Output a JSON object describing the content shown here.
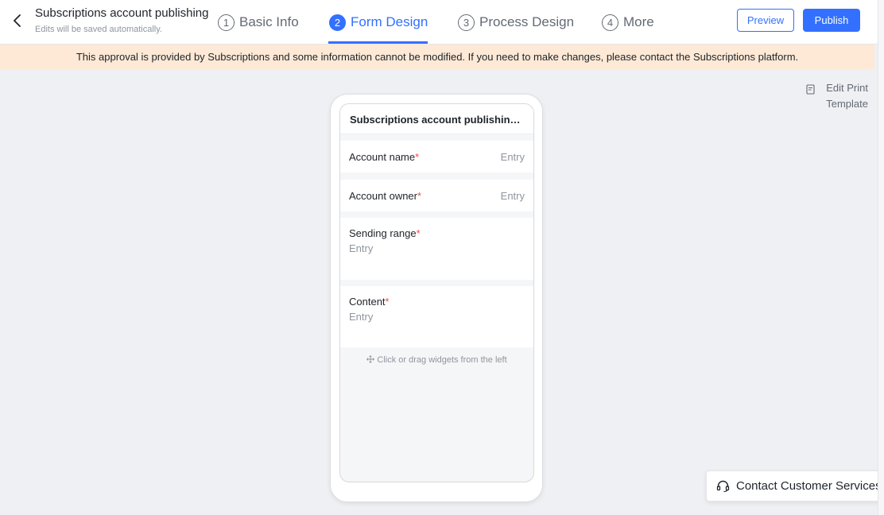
{
  "header": {
    "title": "Subscriptions account publishing",
    "subtitle": "Edits will be saved automatically.",
    "steps": [
      {
        "num": "1",
        "label": "Basic Info"
      },
      {
        "num": "2",
        "label": "Form Design"
      },
      {
        "num": "3",
        "label": "Process Design"
      },
      {
        "num": "4",
        "label": "More"
      }
    ],
    "active_step": 1,
    "preview_label": "Preview",
    "publish_label": "Publish"
  },
  "notice": "This approval is provided by Subscriptions and some information cannot be modified. If you need to make changes, please contact the Subscriptions platform.",
  "print_template_label": "Edit Print Template",
  "form": {
    "title": "Subscriptions account publishing application",
    "required_mark": "*",
    "fields": [
      {
        "label": "Account name",
        "placeholder": "Entry"
      },
      {
        "label": "Account owner",
        "placeholder": "Entry"
      },
      {
        "label": "Sending range",
        "placeholder": "Entry"
      },
      {
        "label": "Content",
        "placeholder": "Entry"
      }
    ],
    "drop_hint": "Click or drag widgets from the left"
  },
  "support": {
    "label": "Contact Customer Services"
  },
  "colors": {
    "accent": "#3370ff",
    "notice_bg": "#fde9d6",
    "required": "#f54a45"
  },
  "icons": [
    "back-arrow-icon",
    "print-template-icon",
    "move-icon",
    "headset-icon"
  ]
}
